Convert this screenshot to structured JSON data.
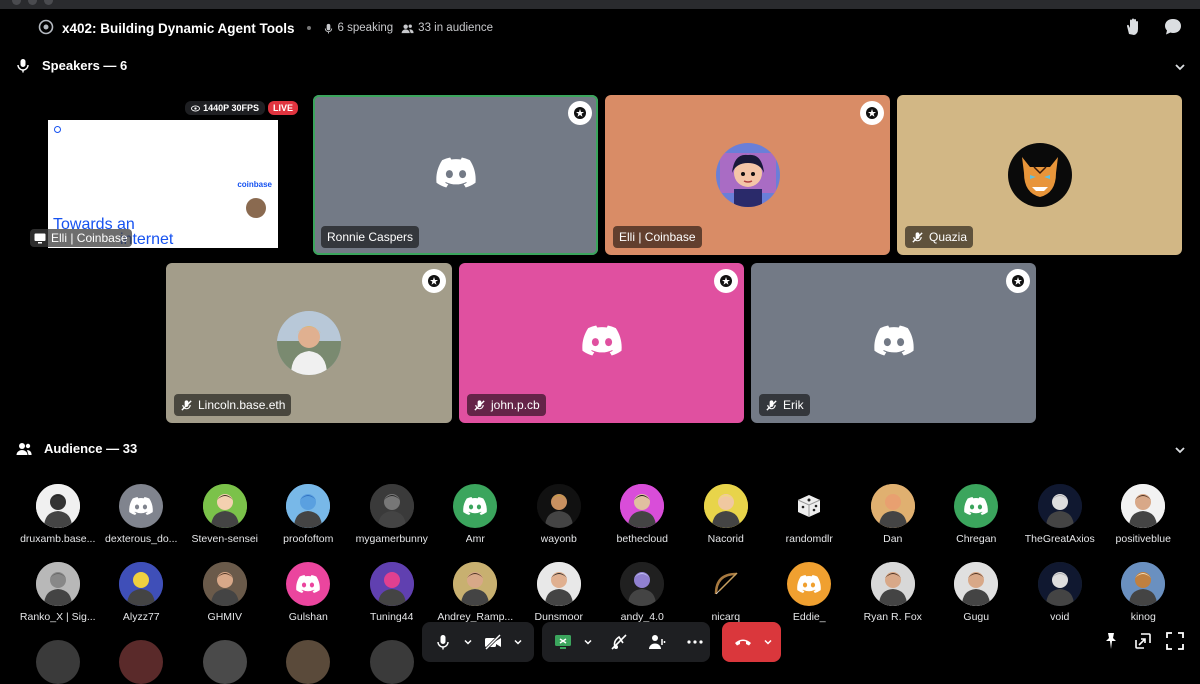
{
  "header": {
    "title": "x402: Building Dynamic Agent Tools",
    "speaking": "6 speaking",
    "audience": "33 in audience"
  },
  "speakers_section": {
    "label": "Speakers — 6"
  },
  "audience_section": {
    "label": "Audience — 33"
  },
  "stream": {
    "resolution": "1440P 30FPS",
    "live": "LIVE",
    "slide_brand": "coinbase",
    "slide_title": "Towards an",
    "slide_title2": "internet",
    "name": "Elli | Coinbase"
  },
  "speakers": [
    {
      "name": "Ronnie Caspers",
      "bg": "#737a86",
      "avatar": "discord-logo",
      "muted": false,
      "active": true
    },
    {
      "name": "Elli | Coinbase",
      "bg": "#d98c66",
      "avatar": "cartoon-girl",
      "muted": false,
      "active": false
    },
    {
      "name": "Quazia",
      "bg": "#d2b785",
      "avatar": "demon-mask",
      "muted": true,
      "active": false
    },
    {
      "name": "Lincoln.base.eth",
      "bg": "#a39d8a",
      "avatar": "photo-man",
      "muted": true,
      "active": false
    },
    {
      "name": "john.p.cb",
      "bg": "#e050a0",
      "avatar": "discord-logo",
      "muted": true,
      "active": false
    },
    {
      "name": "Erik",
      "bg": "#737a86",
      "avatar": "discord-logo",
      "muted": true,
      "active": false
    }
  ],
  "audience_row1": [
    {
      "name": "druxamb.base...",
      "color": "#f0f0f0",
      "icon": "pixel-art"
    },
    {
      "name": "dexterous_do...",
      "color": "#80848e",
      "icon": "discord-logo"
    },
    {
      "name": "Steven-sensei",
      "color": "#7bc24a",
      "icon": "anime-pair"
    },
    {
      "name": "proofoftom",
      "color": "#78b8e8",
      "icon": "blue-monster"
    },
    {
      "name": "mygamerbunny",
      "color": "#3a3a3a",
      "icon": "lips"
    },
    {
      "name": "Amr",
      "color": "#3ba55d",
      "icon": "discord-logo"
    },
    {
      "name": "wayonb",
      "color": "#111111",
      "icon": "viking"
    },
    {
      "name": "bethecloud",
      "color": "#d94dd9",
      "icon": "pixel-punk"
    },
    {
      "name": "Nacorid",
      "color": "#e8d44a",
      "icon": "blonde"
    },
    {
      "name": "randomdlr",
      "color": "#000000",
      "icon": "dice"
    },
    {
      "name": "Dan",
      "color": "#e0b070",
      "icon": "monk"
    },
    {
      "name": "Chregan",
      "color": "#3ba55d",
      "icon": "discord-logo"
    },
    {
      "name": "TheGreatAxios",
      "color": "#101830",
      "icon": "astronaut"
    },
    {
      "name": "positiveblue",
      "color": "#f2f2f2",
      "icon": "photo-man"
    }
  ],
  "audience_row2": [
    {
      "name": "Ranko_X | Sig...",
      "color": "#b8b8b8",
      "icon": "cat"
    },
    {
      "name": "Alyzz77",
      "color": "#3f4fb8",
      "icon": "yellow-bunny"
    },
    {
      "name": "GHMIV",
      "color": "#6a5a4a",
      "icon": "photo-man"
    },
    {
      "name": "Gulshan",
      "color": "#eb459e",
      "icon": "discord-logo"
    },
    {
      "name": "Tuning44",
      "color": "#6040b0",
      "icon": "pink-creature"
    },
    {
      "name": "Andrey_Ramp...",
      "color": "#c8b070",
      "icon": "photo-man"
    },
    {
      "name": "Dunsmoor",
      "color": "#e8e8e8",
      "icon": "bearded-man"
    },
    {
      "name": "andy_4.0",
      "color": "#202020",
      "icon": "astronaut-halo"
    },
    {
      "name": "nicarq",
      "color": "#000000",
      "icon": "bow"
    },
    {
      "name": "Eddie_",
      "color": "#f0a030",
      "icon": "discord-logo"
    },
    {
      "name": "Ryan R. Fox",
      "color": "#d8d8d8",
      "icon": "photo-man"
    },
    {
      "name": "Gugu",
      "color": "#e0e0e0",
      "icon": "photo-man"
    },
    {
      "name": "void",
      "color": "#2a3a2a",
      "icon": "astronaut"
    },
    {
      "name": "kinog",
      "color": "#6a90c0",
      "icon": "ship"
    }
  ],
  "toolbar": {
    "mic": "microphone-icon",
    "camera": "camera-off-icon",
    "share": "screen-share-icon",
    "activity": "activity-off-icon",
    "soundboard": "soundboard-icon",
    "more": "more-icon",
    "leave": "hang-up-icon"
  },
  "colors": {
    "accent_green": "#3ba55d",
    "danger": "#da373c",
    "active_border": "#3ba55d"
  }
}
